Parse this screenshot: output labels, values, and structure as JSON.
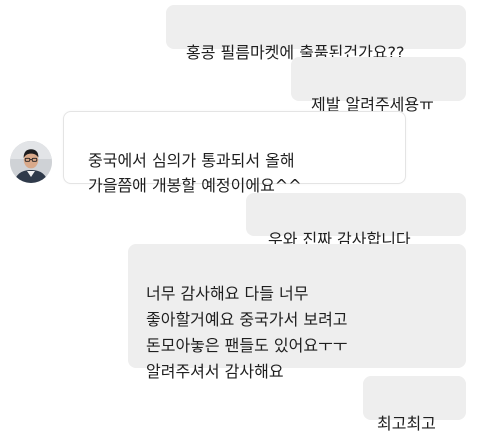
{
  "messages": [
    {
      "direction": "sent",
      "text": "홍콩 필름마켓에 출품된건가요??"
    },
    {
      "direction": "sent",
      "text": "제발 알려주세용ㅠ"
    },
    {
      "direction": "received",
      "text": "중국에서 심의가 통과되서 올해\n가을쯤애 개봉할 예정이에요^^"
    },
    {
      "direction": "sent",
      "text": "우와 진짜 감사합니다"
    },
    {
      "direction": "sent",
      "text": "너무 감사해요 다들 너무\n좋아할거예요 중국가서 보려고\n돈모아놓은 팬들도 있어요ㅜㅜ\n알려주셔서 감사해요"
    },
    {
      "direction": "sent",
      "text": "최고최고"
    }
  ],
  "colors": {
    "sent_bubble": "#eeeeee",
    "received_bubble": "#ffffff",
    "received_border": "#e4e4e4",
    "text": "#1f1f1f",
    "background": "#ffffff"
  },
  "icons": {
    "avatar": "person-photo-avatar"
  }
}
